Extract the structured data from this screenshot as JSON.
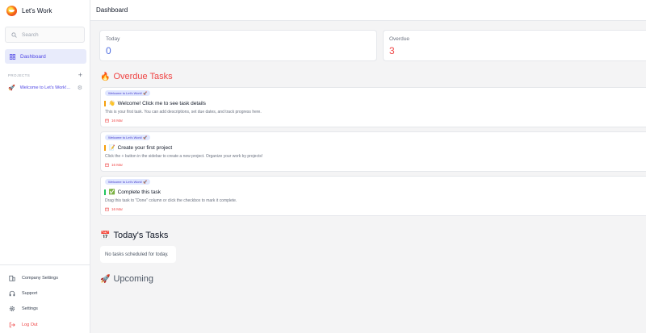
{
  "app": {
    "name": "Let's Work"
  },
  "search": {
    "placeholder": "Search"
  },
  "nav": {
    "dashboard_label": "Dashboard"
  },
  "projects": {
    "header": "PROJECTS",
    "add_symbol": "+",
    "items": [
      {
        "icon": "🚀",
        "name": "Welcome to Let's Work!..."
      }
    ]
  },
  "bottom_nav": {
    "company_settings": "Company Settings",
    "support": "Support",
    "settings": "Settings",
    "logout": "Log Out"
  },
  "header": {
    "title": "Dashboard"
  },
  "stats": {
    "today": {
      "label": "Today",
      "value": "0",
      "color": "#4f6ee0"
    },
    "overdue": {
      "label": "Overdue",
      "value": "3",
      "color": "#ef4444"
    }
  },
  "sections": {
    "overdue": {
      "icon": "🔥",
      "title": "Overdue Tasks",
      "color": "#ef4444"
    },
    "today": {
      "icon": "📅",
      "title": "Today's Tasks",
      "empty": "No tasks scheduled for today."
    },
    "upcoming": {
      "icon": "🚀",
      "title": "Upcoming"
    }
  },
  "tasks": [
    {
      "tag": "Welcome to Let's Work! 🚀",
      "icon": "👋",
      "title": "Welcome! Click me to see task details",
      "description": "This is your first task. You can add descriptions, set due dates, and track progress here.",
      "due": "16 Mar",
      "priority_color": "#f59e0b"
    },
    {
      "tag": "Welcome to Let's Work! 🚀",
      "icon": "📝",
      "title": "Create your first project",
      "description": "Click the + button in the sidebar to create a new project. Organize your work by projects!",
      "due": "16 Mar",
      "priority_color": "#f59e0b"
    },
    {
      "tag": "Welcome to Let's Work! 🚀",
      "icon": "✅",
      "title": "Complete this task",
      "description": "Drag this task to \"Done\" column or click the checkbox to mark it complete.",
      "due": "16 Mar",
      "priority_color": "#22c55e"
    }
  ]
}
